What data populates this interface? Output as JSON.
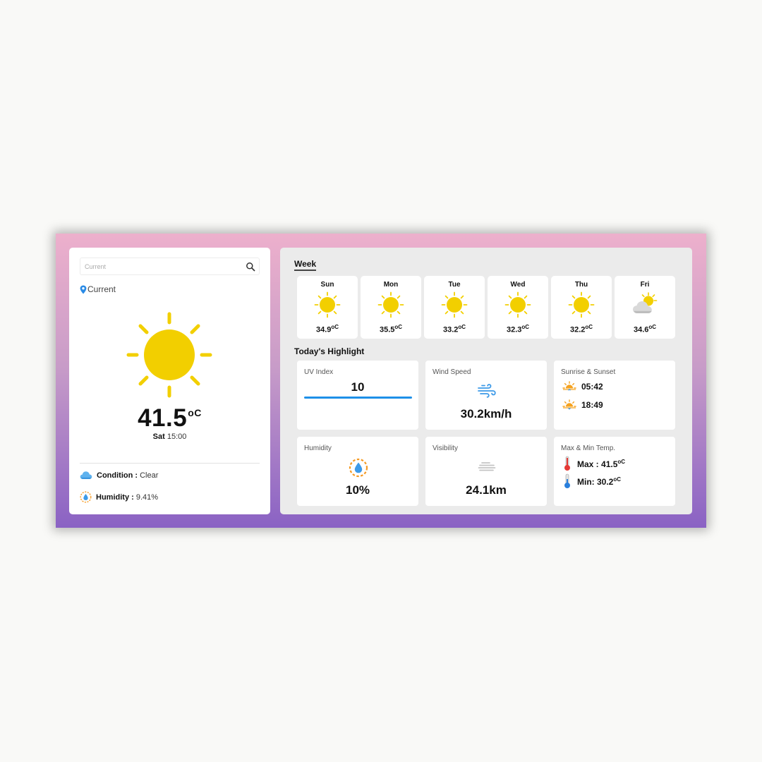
{
  "search": {
    "placeholder": "Current"
  },
  "location": {
    "label": "Current"
  },
  "current": {
    "temp": "41.5",
    "unit": "oC",
    "day": "Sat",
    "time": "15:00"
  },
  "details": {
    "condition_label": "Condition :",
    "condition_value": "Clear",
    "humidity_label": "Humidity :",
    "humidity_value": "9.41%"
  },
  "week": {
    "title": "Week",
    "days": [
      {
        "name": "Sun",
        "temp": "34.9",
        "unit": "oC",
        "icon": "sun-icon"
      },
      {
        "name": "Mon",
        "temp": "35.5",
        "unit": "oC",
        "icon": "sun-icon"
      },
      {
        "name": "Tue",
        "temp": "33.2",
        "unit": "oC",
        "icon": "sun-icon"
      },
      {
        "name": "Wed",
        "temp": "32.3",
        "unit": "oC",
        "icon": "sun-icon"
      },
      {
        "name": "Thu",
        "temp": "32.2",
        "unit": "oC",
        "icon": "sun-icon"
      },
      {
        "name": "Fri",
        "temp": "34.6",
        "unit": "oC",
        "icon": "partly-cloudy-icon"
      }
    ]
  },
  "highlights": {
    "title": "Today's Highlight",
    "uv": {
      "label": "UV Index",
      "value": "10"
    },
    "wind": {
      "label": "Wind Speed",
      "value": "30.2km/h"
    },
    "sun": {
      "label": "Sunrise & Sunset",
      "sunrise": "05:42",
      "sunset": "18:49"
    },
    "humidity": {
      "label": "Humidity",
      "value": "10%"
    },
    "visibility": {
      "label": "Visibility",
      "value": "24.1km"
    },
    "temps": {
      "label": "Max & Min Temp.",
      "max_label": "Max :",
      "max_value": "41.5",
      "min_label": "Min:",
      "min_value": "30.2",
      "unit": "oC"
    }
  },
  "colors": {
    "sun": "#f2cf00",
    "accent": "#1e90e8",
    "gradient_top": "#edb0cc",
    "gradient_bottom": "#8a62c4"
  }
}
